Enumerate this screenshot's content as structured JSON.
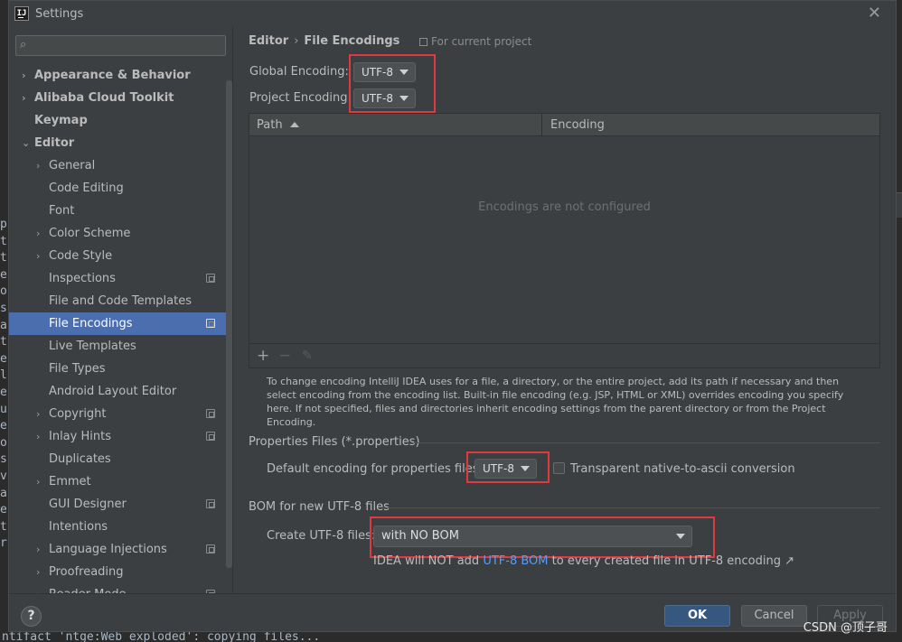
{
  "window": {
    "title": "Settings",
    "icon_letter": "IJ"
  },
  "sidebar": {
    "search_placeholder": "",
    "items": [
      {
        "label": "Appearance & Behavior",
        "level": 0,
        "arrow": "›",
        "bold": true
      },
      {
        "label": "Alibaba Cloud Toolkit",
        "level": 0,
        "arrow": "›",
        "bold": true
      },
      {
        "label": "Keymap",
        "level": 0,
        "arrow": "",
        "bold": true
      },
      {
        "label": "Editor",
        "level": 0,
        "arrow": "⌄",
        "bold": true
      },
      {
        "label": "General",
        "level": 1,
        "arrow": "›"
      },
      {
        "label": "Code Editing",
        "level": 1,
        "arrow": ""
      },
      {
        "label": "Font",
        "level": 1,
        "arrow": ""
      },
      {
        "label": "Color Scheme",
        "level": 1,
        "arrow": "›"
      },
      {
        "label": "Code Style",
        "level": 1,
        "arrow": "›"
      },
      {
        "label": "Inspections",
        "level": 1,
        "arrow": "",
        "project": true
      },
      {
        "label": "File and Code Templates",
        "level": 1,
        "arrow": ""
      },
      {
        "label": "File Encodings",
        "level": 1,
        "arrow": "",
        "project": true,
        "selected": true
      },
      {
        "label": "Live Templates",
        "level": 1,
        "arrow": ""
      },
      {
        "label": "File Types",
        "level": 1,
        "arrow": ""
      },
      {
        "label": "Android Layout Editor",
        "level": 1,
        "arrow": ""
      },
      {
        "label": "Copyright",
        "level": 1,
        "arrow": "›",
        "project": true
      },
      {
        "label": "Inlay Hints",
        "level": 1,
        "arrow": "›",
        "project": true
      },
      {
        "label": "Duplicates",
        "level": 1,
        "arrow": ""
      },
      {
        "label": "Emmet",
        "level": 1,
        "arrow": "›"
      },
      {
        "label": "GUI Designer",
        "level": 1,
        "arrow": "",
        "project": true
      },
      {
        "label": "Intentions",
        "level": 1,
        "arrow": ""
      },
      {
        "label": "Language Injections",
        "level": 1,
        "arrow": "›",
        "project": true
      },
      {
        "label": "Proofreading",
        "level": 1,
        "arrow": "›"
      },
      {
        "label": "Reader Mode",
        "level": 1,
        "arrow": "›",
        "project": true
      }
    ]
  },
  "breadcrumb": {
    "parent": "Editor",
    "separator": "›",
    "current": "File Encodings"
  },
  "for_project": "For current project",
  "global_encoding": {
    "label": "Global Encoding:",
    "value": "UTF-8"
  },
  "project_encoding": {
    "label": "Project Encoding:",
    "value": "UTF-8"
  },
  "table": {
    "columns": [
      "Path",
      "Encoding"
    ],
    "empty_text": "Encodings are not configured",
    "toolbar": [
      "+",
      "−",
      "✎"
    ]
  },
  "note": "To change encoding IntelliJ IDEA uses for a file, a directory, or the entire project, add its path if necessary and then select encoding from the encoding list. Built-in file encoding (e.g. JSP, HTML or XML) overrides encoding you specify here. If not specified, files and directories inherit encoding settings from the parent directory or from the Project Encoding.",
  "properties": {
    "section": "Properties Files (*.properties)",
    "label": "Default encoding for properties files:",
    "value": "UTF-8",
    "checkbox_label": "Transparent native-to-ascii conversion"
  },
  "bom": {
    "section": "BOM for new UTF-8 files",
    "label": "Create UTF-8 files:",
    "value": "with NO BOM",
    "hint_pre": "IDEA will NOT add ",
    "hint_link": "UTF-8 BOM",
    "hint_post": " to every created file in UTF-8 encoding ↗"
  },
  "footer": {
    "help": "?",
    "ok": "OK",
    "cancel": "Cancel",
    "apply": "Apply"
  },
  "background": {
    "left_letters": [
      "p",
      "t",
      "t",
      "e",
      "o",
      "s",
      "a",
      "t",
      "e",
      "l",
      "e",
      "u",
      "e",
      "o",
      "s",
      "v",
      "a",
      "e",
      "t",
      "r"
    ],
    "bottom_text": "ntifact 'ntge:Web exploded': copying files..."
  },
  "watermark": "CSDN @顶子哥",
  "colors": {
    "accent": "#4b6eaf",
    "highlight_box": "#e0393f",
    "link": "#589df6"
  }
}
